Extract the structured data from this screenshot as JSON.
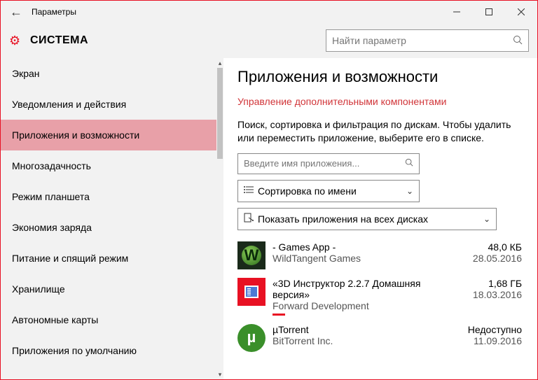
{
  "window": {
    "title": "Параметры"
  },
  "header": {
    "heading": "СИСТЕМА",
    "search_placeholder": "Найти параметр"
  },
  "sidebar": {
    "items": [
      {
        "label": "Экран",
        "active": false
      },
      {
        "label": "Уведомления и действия",
        "active": false
      },
      {
        "label": "Приложения и возможности",
        "active": true
      },
      {
        "label": "Многозадачность",
        "active": false
      },
      {
        "label": "Режим планшета",
        "active": false
      },
      {
        "label": "Экономия заряда",
        "active": false
      },
      {
        "label": "Питание и спящий режим",
        "active": false
      },
      {
        "label": "Хранилище",
        "active": false
      },
      {
        "label": "Автономные карты",
        "active": false
      },
      {
        "label": "Приложения по умолчанию",
        "active": false
      }
    ]
  },
  "content": {
    "title": "Приложения и возможности",
    "manage_link": "Управление дополнительными компонентами",
    "description": "Поиск, сортировка и фильтрация по дискам. Чтобы удалить или переместить приложение, выберите его в списке.",
    "filter_placeholder": "Введите имя приложения...",
    "sort_label": "Сортировка по имени",
    "disk_label": "Показать приложения на всех дисках"
  },
  "apps": [
    {
      "name": "- Games App -",
      "publisher": "WildTangent Games",
      "size": "48,0 КБ",
      "date": "28.05.2016",
      "icon": "games"
    },
    {
      "name": "«3D Инструктор 2.2.7 Домашняя версия»",
      "publisher": "Forward Development",
      "size": "1,68 ГБ",
      "date": "18.03.2016",
      "icon": "red"
    },
    {
      "name": "µTorrent",
      "publisher": "BitTorrent Inc.",
      "size": "Недоступно",
      "date": "11.09.2016",
      "icon": "ut"
    }
  ]
}
